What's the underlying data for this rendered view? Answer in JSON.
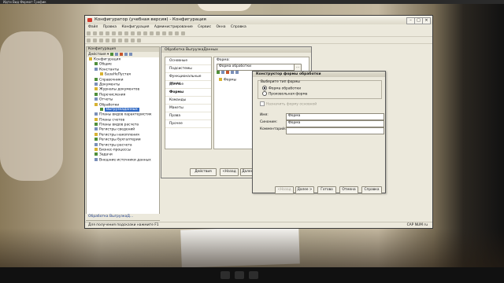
{
  "top_strip_text": "Идти   Вид     Формат   График",
  "window": {
    "title": "Конфигуратор (учебная версия) - Конфигурация",
    "menu": [
      "Файл",
      "Правка",
      "Конфигурация",
      "Администрирование",
      "Сервис",
      "Окна",
      "Справка"
    ],
    "status_text": "Для получения подсказки нажмите F1",
    "status_right": "CAP  NUM  ru"
  },
  "tree_panel": {
    "header": "Конфигурация",
    "actions_label": "Действия",
    "items": [
      {
        "label": "Конфигурация",
        "indent": 0,
        "icon": "config-icon"
      },
      {
        "label": "Общие",
        "indent": 1,
        "icon": "common-icon"
      },
      {
        "label": "Константы",
        "indent": 1,
        "icon": "constants-icon"
      },
      {
        "label": "БазаНеПустая",
        "indent": 2,
        "icon": "constant-icon"
      },
      {
        "label": "Справочники",
        "indent": 1,
        "icon": "catalogs-icon"
      },
      {
        "label": "Документы",
        "indent": 1,
        "icon": "documents-icon"
      },
      {
        "label": "Журналы документов",
        "indent": 1,
        "icon": "journals-icon"
      },
      {
        "label": "Перечисления",
        "indent": 1,
        "icon": "enums-icon"
      },
      {
        "label": "Отчеты",
        "indent": 1,
        "icon": "reports-icon"
      },
      {
        "label": "Обработки",
        "indent": 1,
        "icon": "processings-icon"
      },
      {
        "label": "ВыгрузкаДанных",
        "indent": 2,
        "icon": "processing-icon",
        "selected": true
      },
      {
        "label": "Планы видов характеристик",
        "indent": 1,
        "icon": "chart-types-icon"
      },
      {
        "label": "Планы счетов",
        "indent": 1,
        "icon": "accounts-icon"
      },
      {
        "label": "Планы видов расчета",
        "indent": 1,
        "icon": "calc-types-icon"
      },
      {
        "label": "Регистры сведений",
        "indent": 1,
        "icon": "info-registers-icon"
      },
      {
        "label": "Регистры накопления",
        "indent": 1,
        "icon": "accum-registers-icon"
      },
      {
        "label": "Регистры бухгалтерии",
        "indent": 1,
        "icon": "acc-registers-icon"
      },
      {
        "label": "Регистры расчета",
        "indent": 1,
        "icon": "calc-registers-icon"
      },
      {
        "label": "Бизнес-процессы",
        "indent": 1,
        "icon": "business-process-icon"
      },
      {
        "label": "Задачи",
        "indent": 1,
        "icon": "tasks-icon"
      },
      {
        "label": "Внешние источники данных",
        "indent": 1,
        "icon": "external-sources-icon"
      }
    ],
    "bottom_tab": "Обработка ВыгрузкаД..."
  },
  "processing_window": {
    "title": "Обработка ВыгрузкаДанных",
    "nav": [
      "Основные",
      "Подсистемы",
      "Функциональные опции",
      "Данные",
      "Формы",
      "Команды",
      "Макеты",
      "Права",
      "Прочее"
    ],
    "current_nav": "Формы",
    "forms_label": "Форма:",
    "forms_field": "Форма обработки",
    "forms_list_item": "Формы",
    "buttons": [
      "Действия",
      "<Назад",
      "Далее>"
    ]
  },
  "dialog": {
    "title": "Конструктор формы обработки",
    "group_title": "Выберите тип формы",
    "radio_options": [
      {
        "label": "Форма обработки",
        "checked": true
      },
      {
        "label": "Произвольная форма",
        "checked": false
      }
    ],
    "checkbox_label": "Назначить форму основной",
    "name_label": "Имя:",
    "name_value": "Форма",
    "synonym_label": "Синоним:",
    "synonym_value": "Форма",
    "comment_label": "Комментарий:",
    "comment_value": "",
    "buttons": [
      "<Назад",
      "Далее >",
      "Готово",
      "Отмена",
      "Справка"
    ]
  }
}
